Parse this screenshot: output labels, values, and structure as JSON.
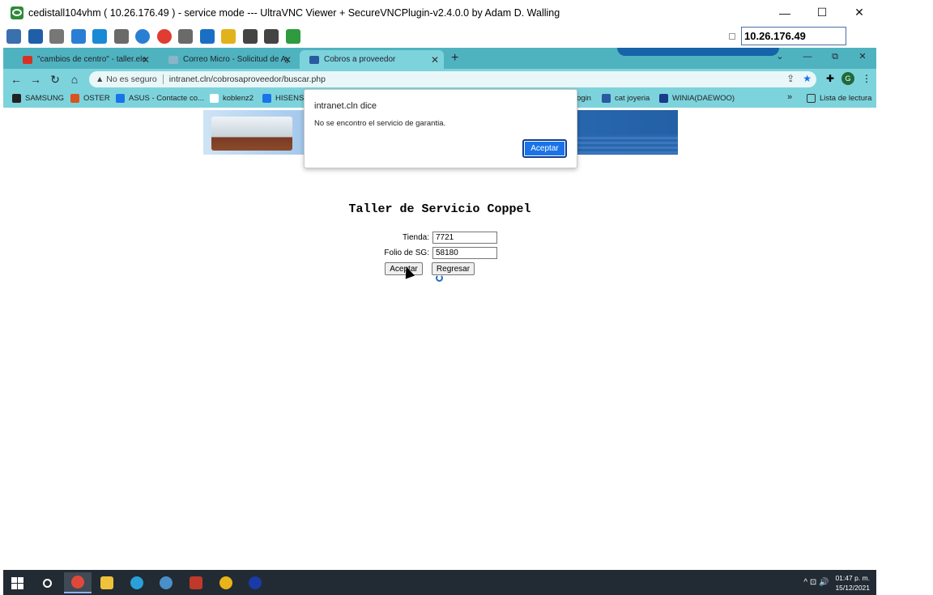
{
  "vnc": {
    "title": "cedistall104vhm ( 10.26.176.49 ) - service mode --- UltraVNC Viewer + SecureVNCPlugin-v2.4.0.0 by Adam D. Walling",
    "minimize": "—",
    "maximize": "☐",
    "close": "✕",
    "ip_value": "10.26.176.49",
    "toolbar_icons": [
      "connection-options-icon",
      "fullscreen-icon",
      "settings-icon",
      "refresh-icon",
      "windows-key-icon",
      "ctrl-alt-del-icon",
      "info-icon",
      "disconnect-icon",
      "file-transfer-icon",
      "screen-icon",
      "folder-icon",
      "select-window-icon",
      "full-desktop-icon",
      "chat-icon"
    ],
    "toolbar_colors": [
      "#3a6fb0",
      "#1f5fa8",
      "#777777",
      "#2a7fd4",
      "#1a8ad4",
      "#6a6a6a",
      "#2a7fd4",
      "#e03c31",
      "#6a6a6a",
      "#1a6fc4",
      "#e2b21a",
      "#444444",
      "#444444",
      "#2e9b3e"
    ]
  },
  "browser": {
    "tabs": [
      {
        "label": "\"cambios de centro\" - taller.elect",
        "icon": "gmail-icon",
        "color": "#d93025"
      },
      {
        "label": "Correo Micro - Solicitud de Ayud",
        "icon": "mail-icon",
        "color": "#8ab4c8"
      },
      {
        "label": "Cobros a proveedor",
        "icon": "page-icon",
        "color": "#2a5aa0"
      }
    ],
    "new_tab": "+",
    "strip_controls": [
      "⌄",
      "—",
      "⧉",
      "✕"
    ],
    "nav": {
      "back": "←",
      "forward": "→",
      "reload": "↻",
      "home": "⌂"
    },
    "not_secure": "▲ No es seguro",
    "url": "intranet.cln/cobrosaproveedor/buscar.php",
    "bookmarks": [
      {
        "label": "SAMSUNG",
        "color": "#222222"
      },
      {
        "label": "OSTER",
        "color": "#d9531e"
      },
      {
        "label": "ASUS - Contacte co...",
        "color": "#1a73e8"
      },
      {
        "label": "koblenz2",
        "color": "#ffffff"
      },
      {
        "label": "HISENSE",
        "color": "#1a73e8"
      },
      {
        "label": "ogin",
        "color": "#7dd3dc"
      },
      {
        "label": "cat joyeria",
        "color": "#2a5aa0"
      },
      {
        "label": "WINIA(DAEWOO)",
        "color": "#1a3a8a"
      }
    ],
    "bookmarks_more": "»",
    "reading_list": "Lista de lectura",
    "avatar_letter": "G"
  },
  "page": {
    "heading": "Taller de Servicio Coppel",
    "tienda_label": "Tienda:",
    "tienda_value": "7721",
    "folio_label": "Folio de SG:",
    "folio_value": "58180",
    "aceptar": "Aceptar",
    "regresar": "Regresar"
  },
  "dialog": {
    "title": "intranet.cln dice",
    "message": "No se encontro el servicio de garantia.",
    "ok": "Aceptar"
  },
  "taskbar": {
    "apps": [
      {
        "name": "search-icon",
        "color": "#ffffff"
      },
      {
        "name": "chrome-icon",
        "color": "#e0493a"
      },
      {
        "name": "file-explorer-icon",
        "color": "#f0c23a"
      },
      {
        "name": "edge-icon",
        "color": "#2aa0d8"
      },
      {
        "name": "remote-app-icon",
        "color": "#4a90c8"
      },
      {
        "name": "app-icon",
        "color": "#c0392b"
      },
      {
        "name": "db-app-icon",
        "color": "#e8b41a"
      },
      {
        "name": "uvnc-icon",
        "color": "#1a3aa8"
      }
    ],
    "tray": "^  ⊡  🔊",
    "time": "01:47 p. m.",
    "date": "15/12/2021"
  }
}
